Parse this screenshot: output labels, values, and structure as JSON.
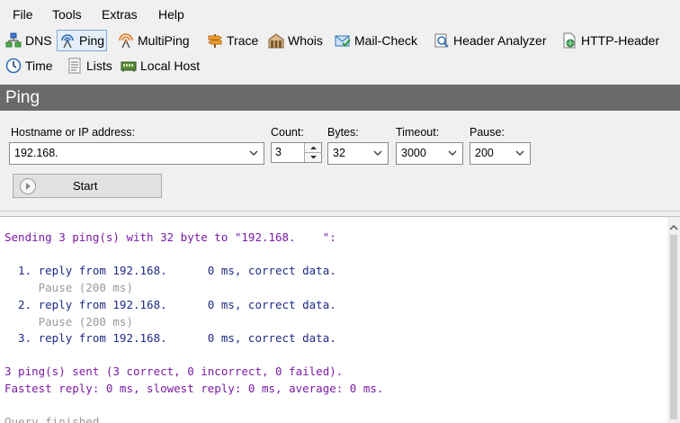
{
  "menu": [
    {
      "label": "File"
    },
    {
      "label": "Tools"
    },
    {
      "label": "Extras"
    },
    {
      "label": "Help"
    }
  ],
  "toolbar": {
    "row1": [
      {
        "label": "DNS",
        "icon": "dns-icon"
      },
      {
        "label": "Ping",
        "icon": "ping-icon",
        "active": true
      },
      {
        "label": "MultiPing",
        "icon": "multiping-icon"
      },
      {
        "label": "Trace",
        "icon": "trace-icon"
      },
      {
        "label": "Whois",
        "icon": "whois-icon"
      },
      {
        "label": "Mail-Check",
        "icon": "mail-check-icon"
      },
      {
        "label": "Header Analyzer",
        "icon": "header-analyzer-icon"
      },
      {
        "label": "HTTP-Header",
        "icon": "http-header-icon"
      }
    ],
    "row2": [
      {
        "label": "Time",
        "icon": "clock-icon"
      },
      {
        "label": "Lists",
        "icon": "lists-icon"
      },
      {
        "label": "Local Host",
        "icon": "local-host-icon"
      }
    ]
  },
  "panel": {
    "title": "Ping"
  },
  "form": {
    "hostname_label": "Hostname or IP address:",
    "hostname_value": "192.168.",
    "count_label": "Count:",
    "count_value": "3",
    "bytes_label": "Bytes:",
    "bytes_value": "32",
    "timeout_label": "Timeout:",
    "timeout_value": "3000",
    "pause_label": "Pause:",
    "pause_value": "200",
    "start_label": "Start"
  },
  "output": {
    "header": "Sending 3 ping(s) with 32 byte to \"192.168.    \":",
    "lines": [
      {
        "text": "  1. reply from 192.168.      0 ms, correct data.",
        "kind": "reply"
      },
      {
        "text": "     Pause (200 ms)",
        "kind": "pause"
      },
      {
        "text": "  2. reply from 192.168.      0 ms, correct data.",
        "kind": "reply"
      },
      {
        "text": "     Pause (200 ms)",
        "kind": "pause"
      },
      {
        "text": "  3. reply from 192.168.      0 ms, correct data.",
        "kind": "reply"
      }
    ],
    "summary1": "3 ping(s) sent (3 correct, 0 incorrect, 0 failed).",
    "summary2": "Fastest reply: 0 ms, slowest reply: 0 ms, average: 0 ms.",
    "footer": "Query finished"
  },
  "colors": {
    "purple_text": "#7b1aa6",
    "navy_text": "#1f2a86",
    "gray_text": "#9a9a9a",
    "title_bar": "#6a6a6a"
  }
}
